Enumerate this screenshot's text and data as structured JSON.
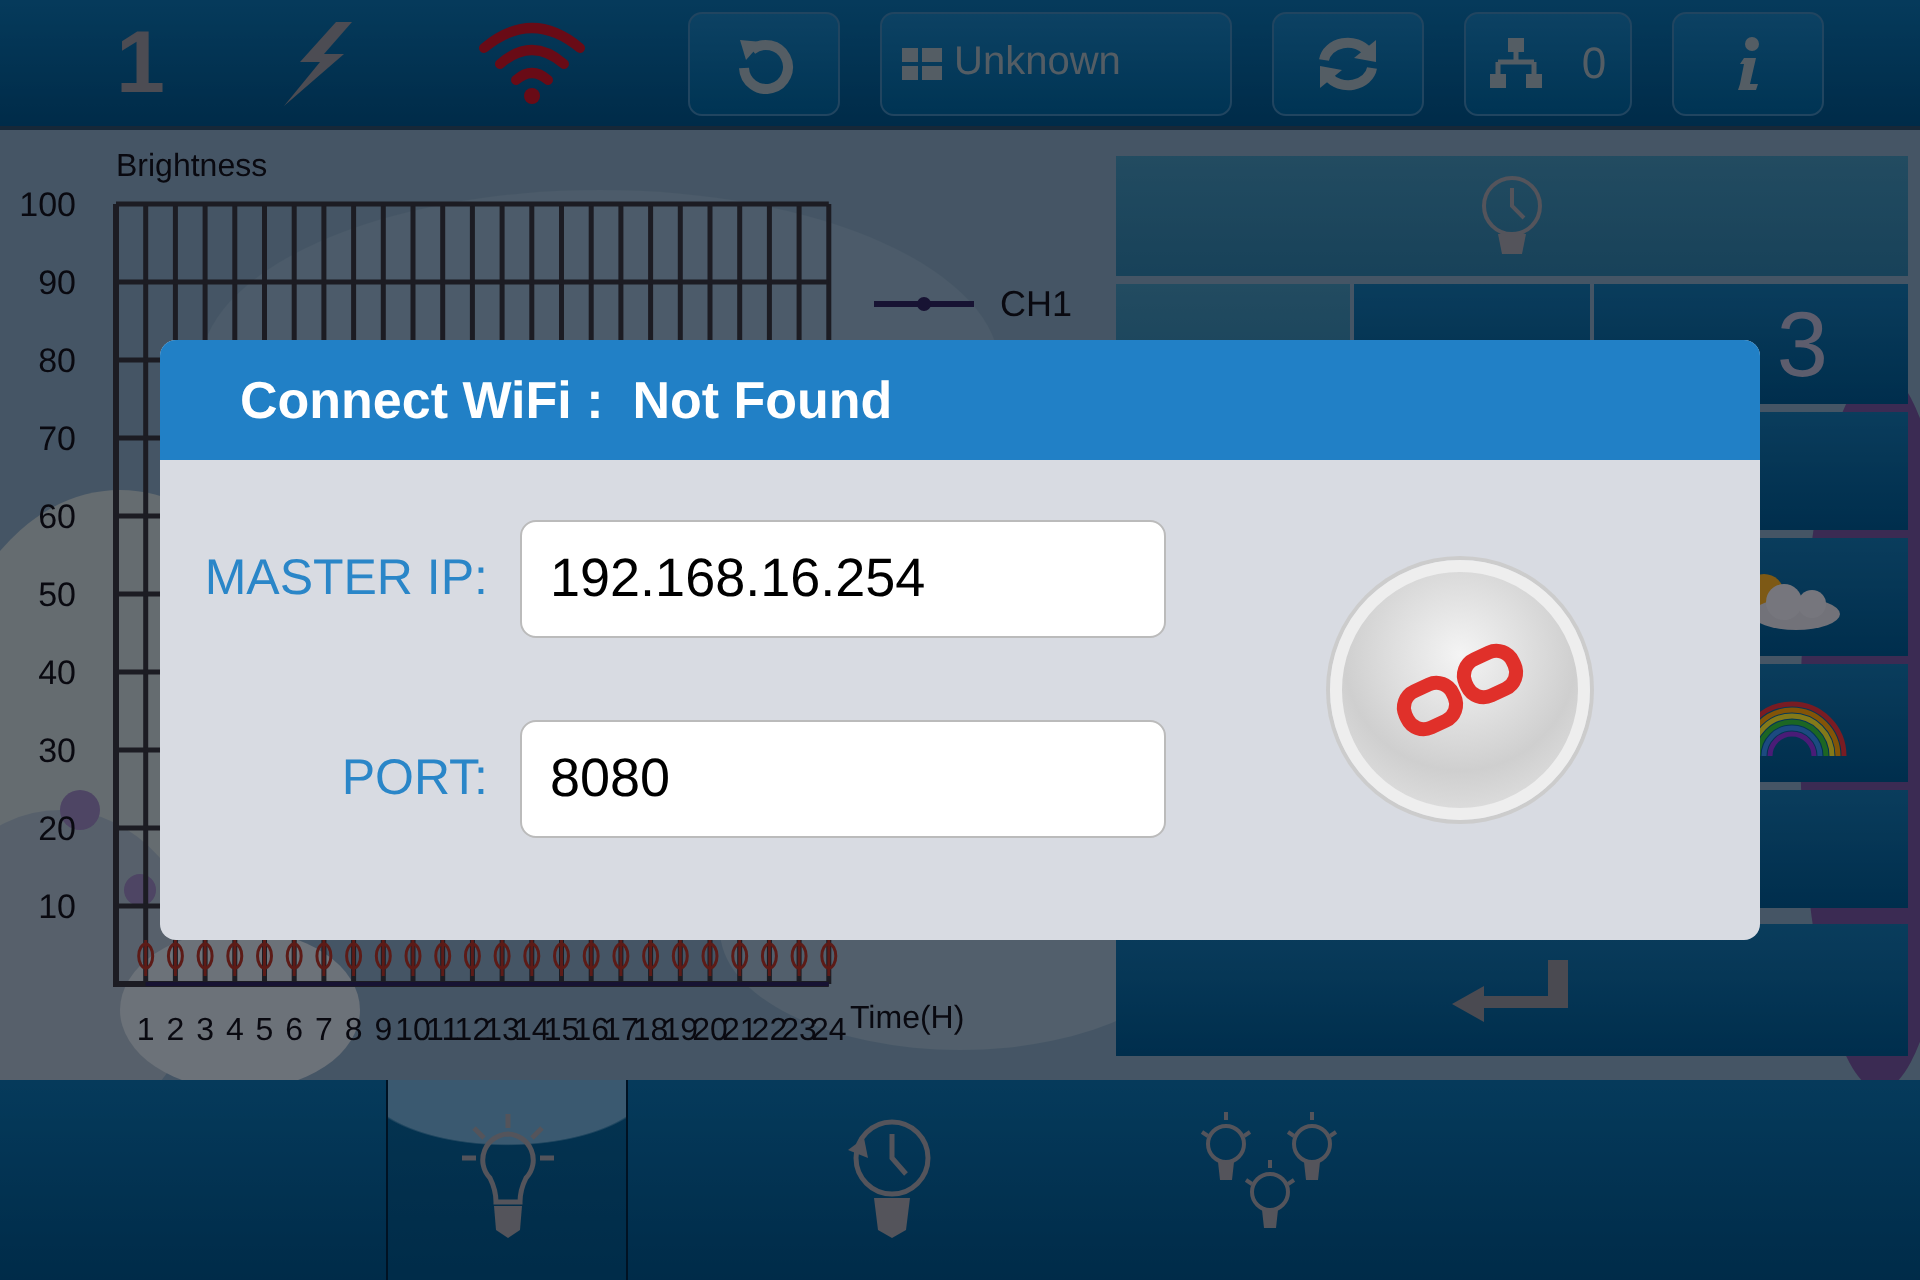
{
  "top_bar": {
    "channel": "1",
    "wifi": {
      "connected": false
    },
    "mode_button": {
      "label": "Unknown"
    },
    "node_count": "0"
  },
  "chart": {
    "chart_data": {
      "type": "line",
      "grid": true,
      "xlim": [
        0,
        24
      ],
      "ylabel": "Brightness",
      "xlabel": "Time(H)",
      "x": [
        1,
        2,
        3,
        4,
        5,
        6,
        7,
        8,
        9,
        10,
        11,
        12,
        13,
        14,
        15,
        16,
        17,
        18,
        19,
        20,
        21,
        22,
        23,
        24
      ],
      "xticks": [
        1,
        2,
        3,
        4,
        5,
        6,
        7,
        8,
        9,
        10,
        11,
        12,
        13,
        14,
        15,
        16,
        17,
        18,
        19,
        20,
        21,
        22,
        23,
        24
      ],
      "ylim": [
        0,
        100
      ],
      "yticks": [
        10,
        20,
        30,
        40,
        50,
        60,
        70,
        80,
        90,
        100
      ],
      "series": [
        {
          "name": "CH1",
          "color": "#2b2350",
          "values": [
            0,
            0,
            0,
            0,
            0,
            0,
            0,
            0,
            0,
            0,
            0,
            0,
            0,
            0,
            0,
            0,
            0,
            0,
            0,
            0,
            0,
            0,
            0,
            0
          ]
        }
      ]
    }
  },
  "right_panel": {
    "preset_3_label": "3"
  },
  "dialog": {
    "title": "Connect WiFi :  Not Found",
    "fields": [
      {
        "label": "MASTER IP:",
        "value": "192.168.16.254"
      },
      {
        "label": "PORT:",
        "value": "8080"
      }
    ]
  },
  "bottom_tabs": [
    {
      "kind": "bulb",
      "selected": true
    },
    {
      "kind": "schedule",
      "selected": false
    },
    {
      "kind": "group",
      "selected": false
    }
  ]
}
